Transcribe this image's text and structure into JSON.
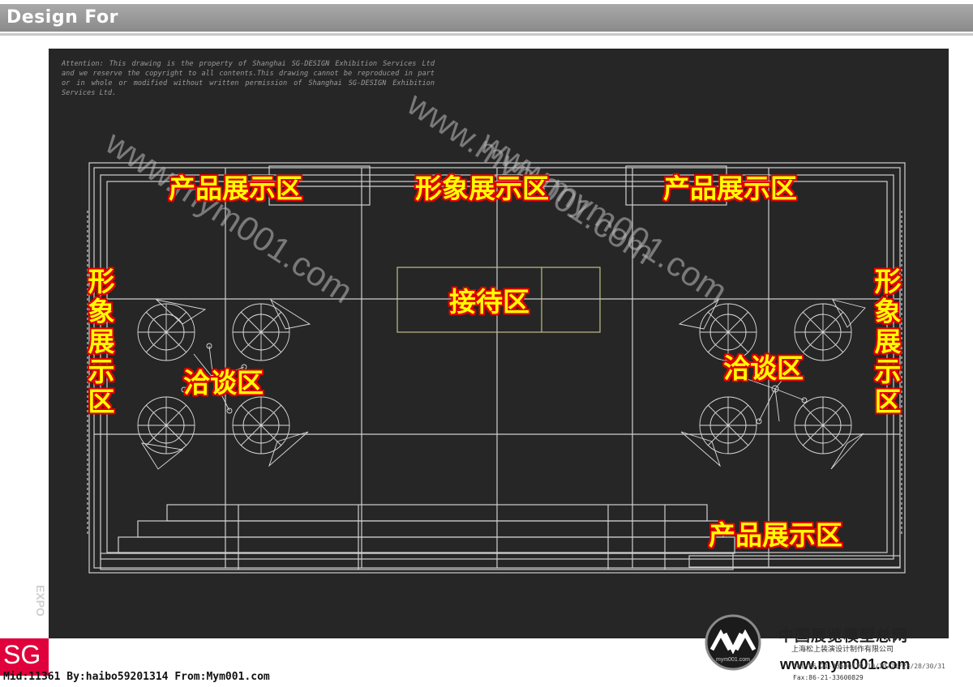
{
  "header": {
    "title": "Design For"
  },
  "notice": "Attention: This drawing is the property of Shanghai SG-DESIGN Exhibition Services Ltd and we reserve the copyright to all contents.This drawing cannot be reproduced in part or in whole or modified without written permission of Shanghai SG-DESIGN Exhibition Services Ltd.",
  "watermarks": [
    "www.mym001.com",
    "www.mym001.com",
    "www.mym001.com"
  ],
  "zones": {
    "product_top_left": "产品展示区",
    "image_top_center": "形象展示区",
    "product_top_right": "产品展示区",
    "reception": "接待区",
    "image_left": "形象展示区",
    "image_right": "形象展示区",
    "negotiation_left": "洽谈区",
    "negotiation_right": "洽谈区",
    "product_bottom_right": "产品展示区"
  },
  "side_mark": "EXPO",
  "logo": {
    "text": "SG",
    "color": "#e0003c"
  },
  "footer": {
    "meta": "Mid:11361 By:haibo59201314 From:Mym001.com"
  },
  "brand": {
    "name_cn": "中国展览模型总网",
    "company_cn": "上海松上装演设计制作有限公司",
    "mark_text": "mym001.com",
    "url": "www.mym001.com",
    "tel": "Tel:86-21-33600170/19/20/21/23/28/30/31",
    "fax": "Fax:86-21-33600829"
  },
  "colors": {
    "canvas": "#262626",
    "lines": "#c8c8c8",
    "zone_text": "#ffff00",
    "zone_outline": "#e00000"
  }
}
